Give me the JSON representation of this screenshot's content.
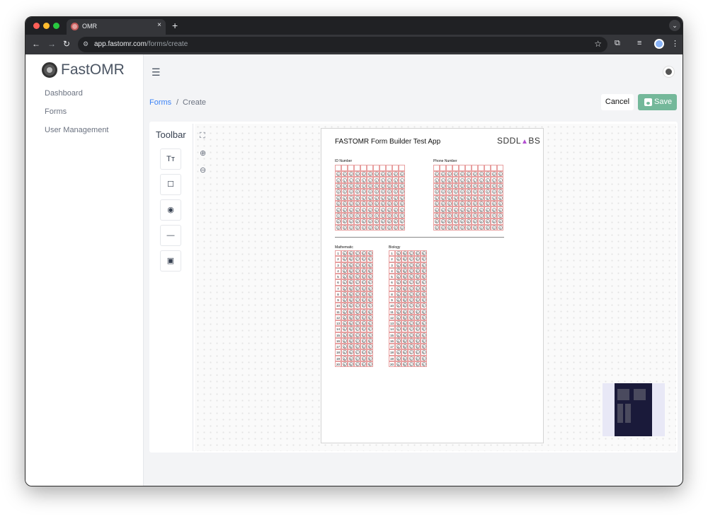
{
  "browser": {
    "tab_title": "OMR",
    "new_tab": "+",
    "tab_close": "×",
    "url_host": "app.fastomr.com",
    "url_path": "/forms/create"
  },
  "app": {
    "logo_text": "FastOMR",
    "nav": [
      {
        "label": "Dashboard"
      },
      {
        "label": "Forms"
      },
      {
        "label": "User Management"
      }
    ]
  },
  "breadcrumb": {
    "link": "Forms",
    "separator": "/",
    "current": "Create"
  },
  "actions": {
    "cancel_label": "Cancel",
    "save_label": "Save"
  },
  "toolbar": {
    "title": "Toolbar",
    "tools": [
      {
        "icon": "text-icon",
        "glyph": "Tт"
      },
      {
        "icon": "rectangle-icon",
        "glyph": "☐"
      },
      {
        "icon": "radio-icon",
        "glyph": "◉"
      },
      {
        "icon": "line-icon",
        "glyph": "—"
      },
      {
        "icon": "image-icon",
        "glyph": "▣"
      }
    ]
  },
  "zoom": {
    "fit_glyph": "⛶",
    "zoom_in_glyph": "⊕",
    "zoom_out_glyph": "⊖"
  },
  "sheet": {
    "title": "FASTOMR Form Builder Test App",
    "logo": {
      "left": "SDDL",
      "mark": "▲",
      "right": "BS"
    },
    "id_label": "ID Number",
    "phone_label": "Phone Number",
    "digit_columns": 11,
    "digits": [
      "0",
      "1",
      "2",
      "3",
      "4",
      "5",
      "6",
      "7",
      "8",
      "9"
    ],
    "sections": [
      {
        "label": "Mathematic",
        "questions": 20
      },
      {
        "label": "Biology",
        "questions": 20
      }
    ],
    "choices": [
      "A",
      "B",
      "C",
      "D",
      "E"
    ]
  },
  "colors": {
    "accent": "#3b82f6",
    "save_button": "#74b89a",
    "grid_border": "#e8a0a0"
  }
}
